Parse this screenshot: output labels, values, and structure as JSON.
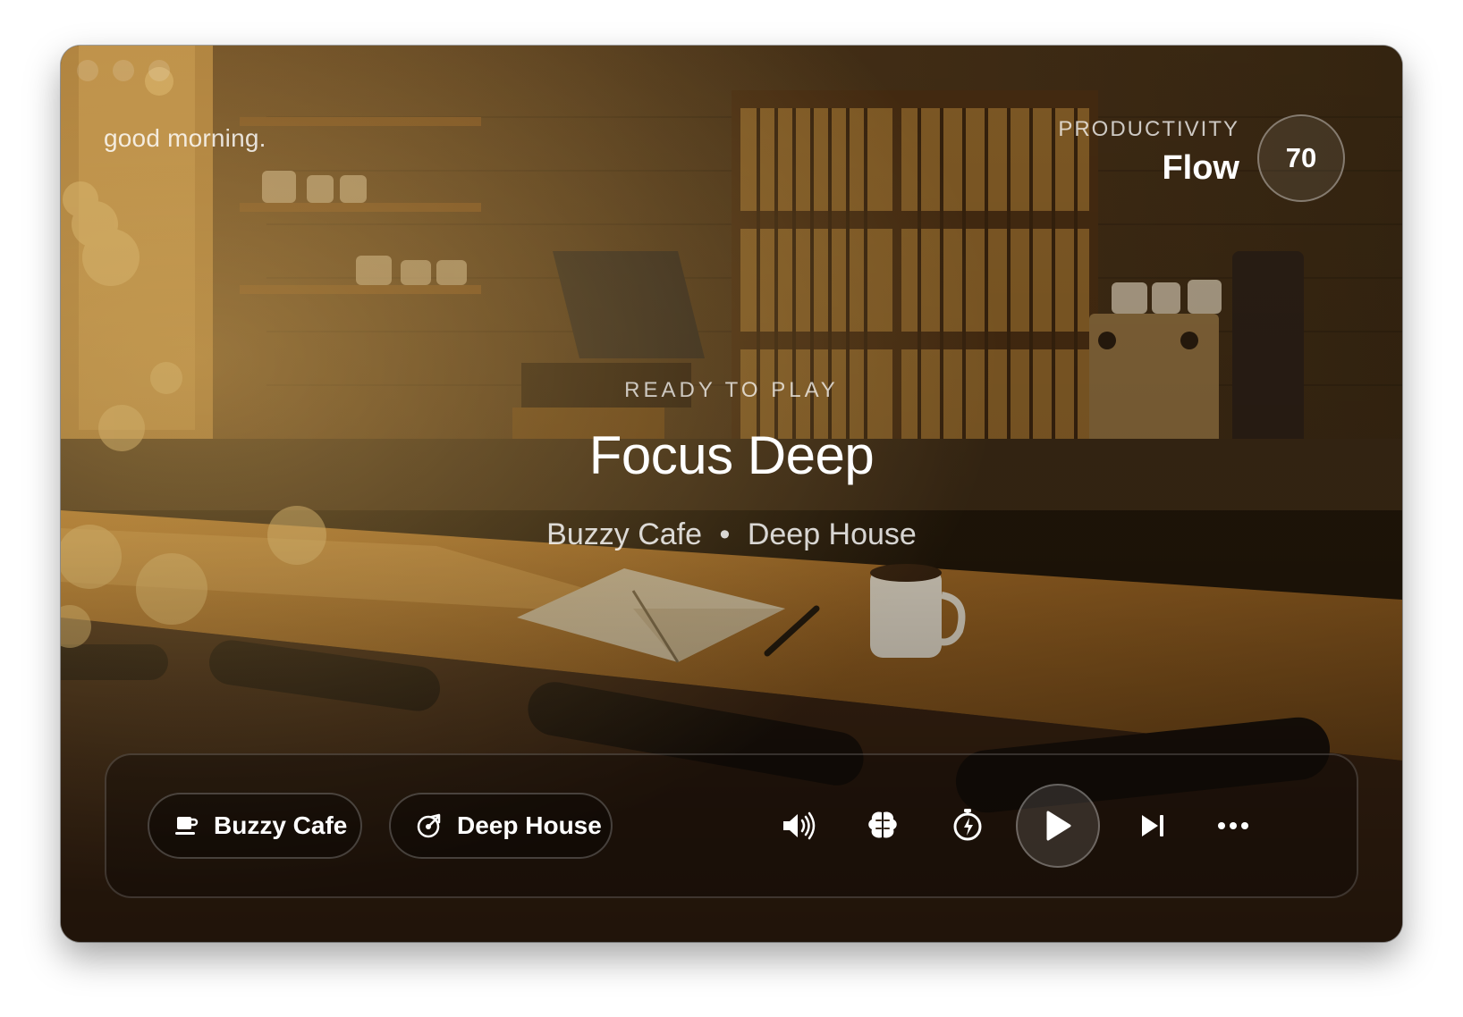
{
  "header": {
    "greeting": "good morning.",
    "productivity_label": "PRODUCTIVITY",
    "productivity_mode": "Flow",
    "productivity_score": "70"
  },
  "now_playing": {
    "status": "READY TO PLAY",
    "title": "Focus Deep",
    "ambience": "Buzzy Cafe",
    "separator": "•",
    "genre": "Deep House"
  },
  "controls": {
    "ambience_chip": {
      "label": "Buzzy Cafe",
      "icon": "coffee-cup-icon"
    },
    "genre_chip": {
      "label": "Deep House",
      "icon": "vinyl-record-icon"
    },
    "volume_icon": "speaker-volume-icon",
    "focus_icon": "brain-icon",
    "timer_icon": "stopwatch-bolt-icon",
    "play_icon": "play-icon",
    "next_icon": "skip-next-icon",
    "more_icon": "more-horizontal-icon"
  }
}
